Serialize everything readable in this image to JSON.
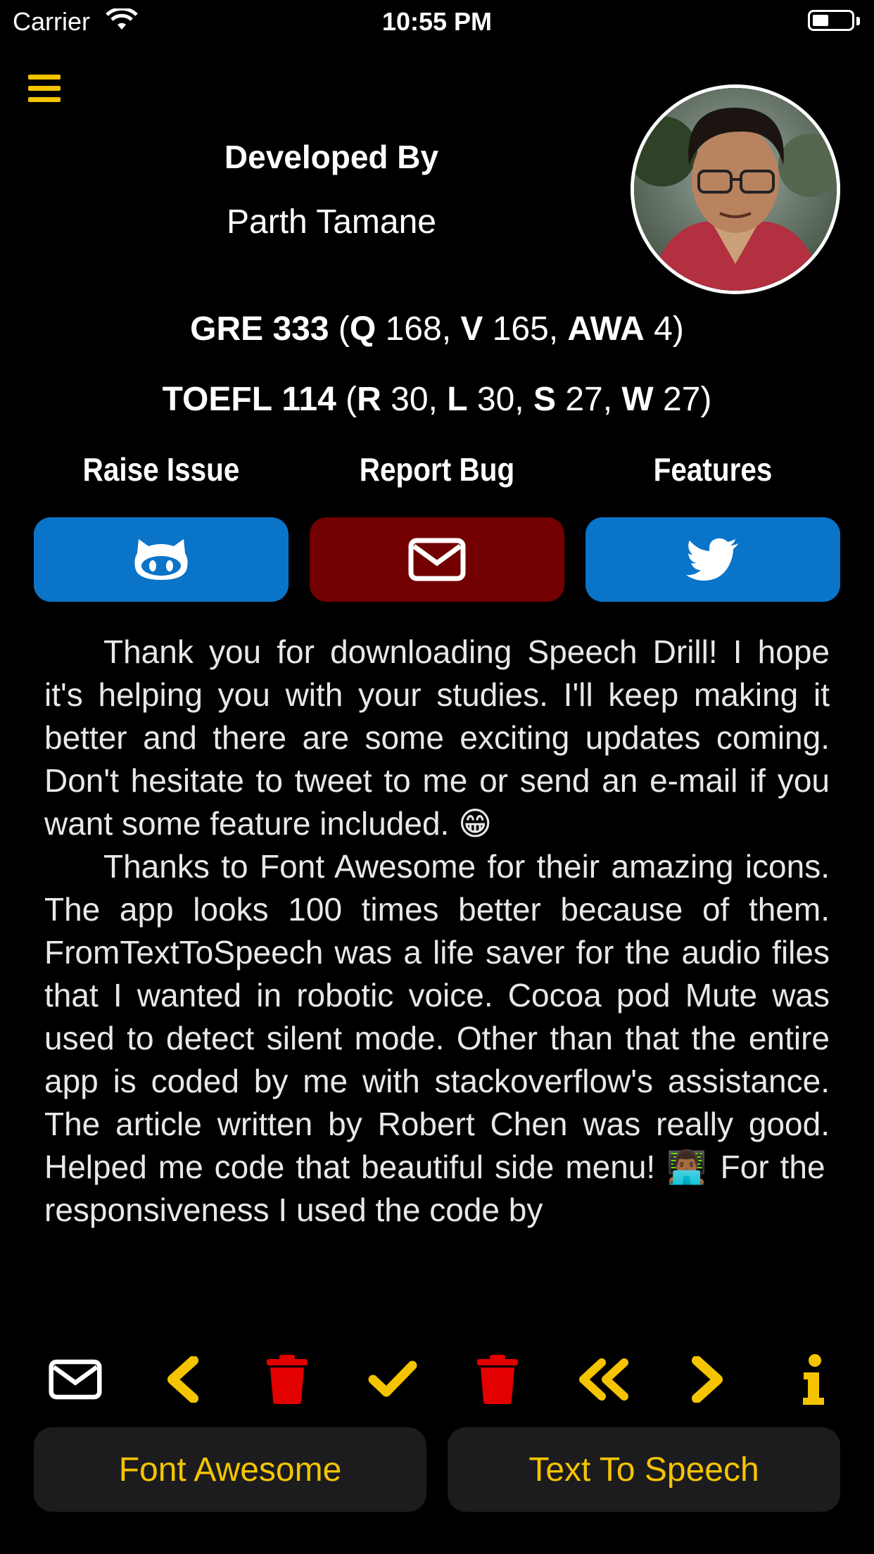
{
  "status_bar": {
    "carrier": "Carrier",
    "time": "10:55 PM"
  },
  "header": {
    "menu_icon": "hamburger-menu-icon",
    "developed_by": "Developed By",
    "developer_name": "Parth Tamane"
  },
  "scores": {
    "gre": {
      "name": "GRE",
      "total": "333",
      "q_label": "Q",
      "q": "168",
      "v_label": "V",
      "v": "165",
      "awa_label": "AWA",
      "awa": "4"
    },
    "toefl": {
      "name": "TOEFL",
      "total": "114",
      "r_label": "R",
      "r": "30",
      "l_label": "L",
      "l": "30",
      "s_label": "S",
      "s": "27",
      "w_label": "W",
      "w": "27"
    }
  },
  "links": [
    {
      "label": "Raise Issue",
      "icon": "github-icon",
      "color": "#0a74c9"
    },
    {
      "label": "Report Bug",
      "icon": "envelope-icon",
      "color": "#720000"
    },
    {
      "label": "Features",
      "icon": "twitter-icon",
      "color": "#0a74c9"
    }
  ],
  "message": {
    "p1": "Thank you for downloading Speech Drill! I hope it's helping you with your studies. I'll  keep making it better and there are some exciting updates coming. Don't hesitate to tweet to me or send an e-mail if you want some feature included. 😁",
    "p2": "Thanks to Font Awesome for their amazing icons. The app looks 100 times better because of them. FromTextToSpeech was a life saver for the audio files that I wanted in robotic voice. Cocoa pod Mute was used to detect silent mode. Other than that the entire app is coded by me with stackoverflow's assistance. The article written by Robert Chen was really good. Helped me code that beautiful side menu! 👨🏾‍💻 For the responsiveness I used the code by"
  },
  "toolbar": [
    "envelope-icon",
    "chevron-left-icon",
    "trash-icon",
    "check-icon",
    "trash-icon",
    "double-chevron-left-icon",
    "chevron-right-icon",
    "info-icon"
  ],
  "buttons": {
    "font_awesome": "Font Awesome",
    "text_to_speech": "Text To Speech"
  },
  "colors": {
    "accent": "#f5c400",
    "delete": "#e30000",
    "blue": "#0a74c9",
    "dark_red": "#720000",
    "button_bg": "#1c1c1e"
  }
}
